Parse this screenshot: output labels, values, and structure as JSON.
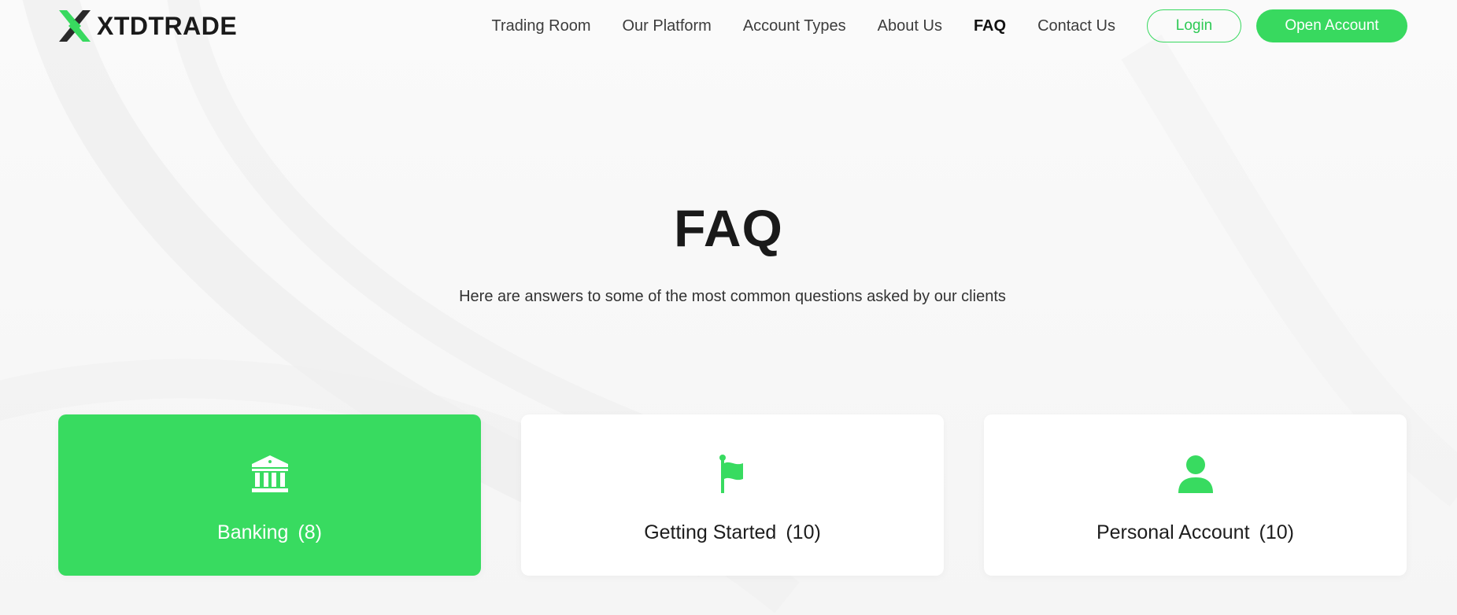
{
  "brand": {
    "name": "XTDTRADE",
    "accent_color": "#38d95f"
  },
  "nav": {
    "items": [
      {
        "label": "Trading Room"
      },
      {
        "label": "Our Platform"
      },
      {
        "label": "Account Types"
      },
      {
        "label": "About Us"
      },
      {
        "label": "FAQ",
        "active": true
      },
      {
        "label": "Contact Us"
      }
    ],
    "login_label": "Login",
    "open_account_label": "Open Account"
  },
  "hero": {
    "title": "FAQ",
    "subtitle": "Here are answers to some of the most common questions asked by our clients"
  },
  "categories": [
    {
      "label": "Banking",
      "count": "(8)",
      "icon": "bank-icon",
      "active": true
    },
    {
      "label": "Getting Started",
      "count": "(10)",
      "icon": "flag-icon",
      "active": false
    },
    {
      "label": "Personal Account",
      "count": "(10)",
      "icon": "user-icon",
      "active": false
    }
  ]
}
